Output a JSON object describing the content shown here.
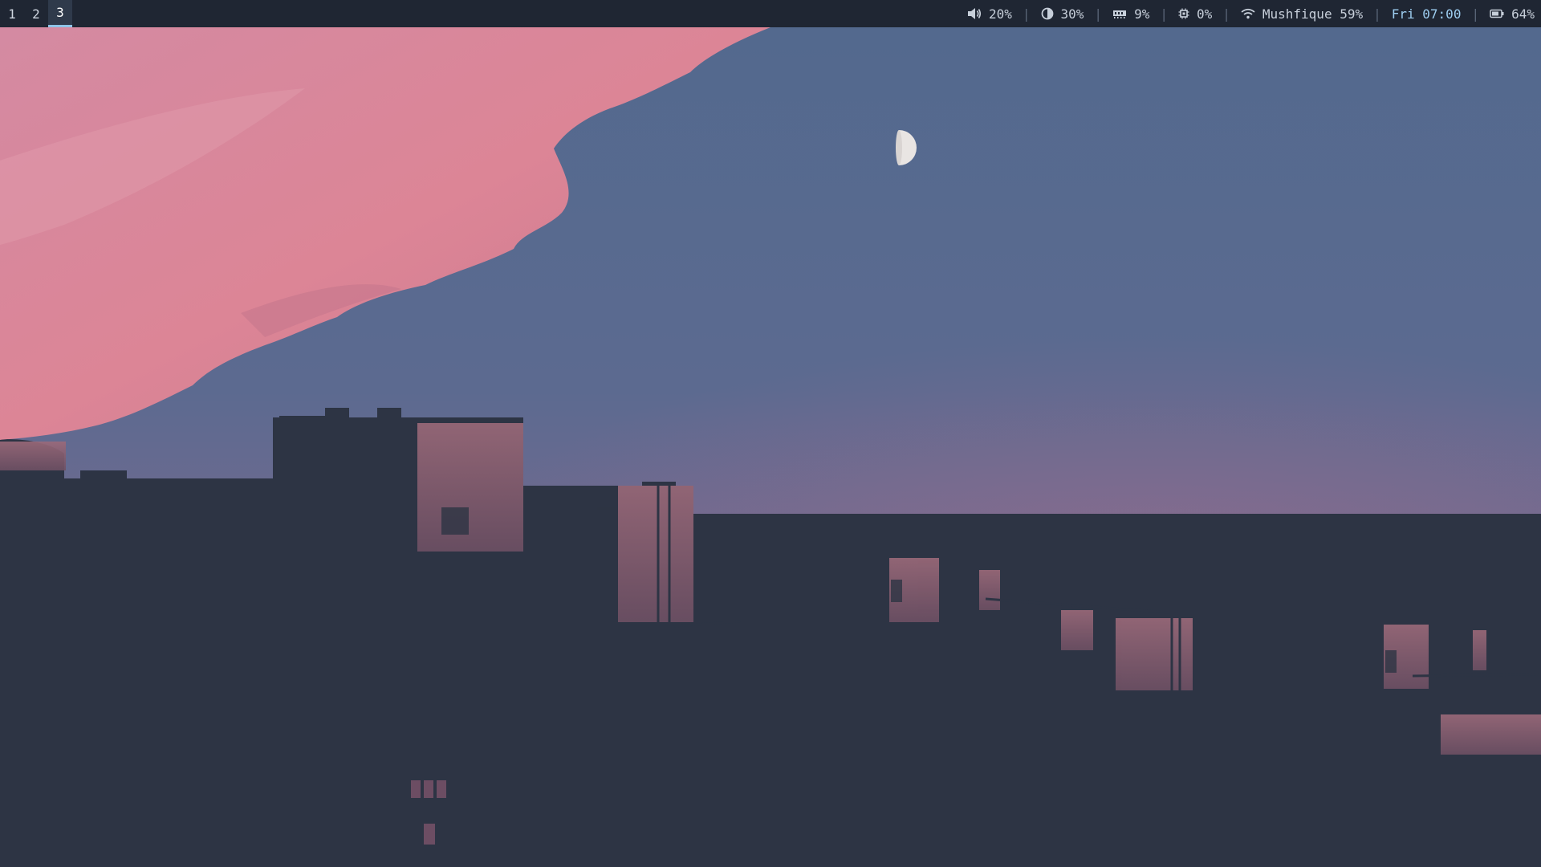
{
  "topbar": {
    "workspaces": [
      {
        "label": "1",
        "active": false
      },
      {
        "label": "2",
        "active": false
      },
      {
        "label": "3",
        "active": true
      }
    ],
    "modules": {
      "volume": {
        "icon": "speaker-icon",
        "value": "20%"
      },
      "brightness": {
        "icon": "brightness-icon",
        "value": "30%"
      },
      "memory": {
        "icon": "memory-icon",
        "value": "9%"
      },
      "cpu": {
        "icon": "cpu-icon",
        "value": "0%"
      },
      "wifi": {
        "icon": "wifi-icon",
        "value": "Mushfique 59%"
      },
      "clock": {
        "value": "Fri 07:00"
      },
      "battery": {
        "icon": "battery-icon",
        "value": "64%"
      }
    },
    "separator": "|"
  },
  "colors": {
    "bar_bg": "#1f2633",
    "active_ws_underline": "#8fc4e8",
    "clock_text": "#9dcdf0",
    "sky_blue": "#556b8e",
    "cloud_pink": "#d9879a",
    "silhouette": "#2d3444"
  }
}
